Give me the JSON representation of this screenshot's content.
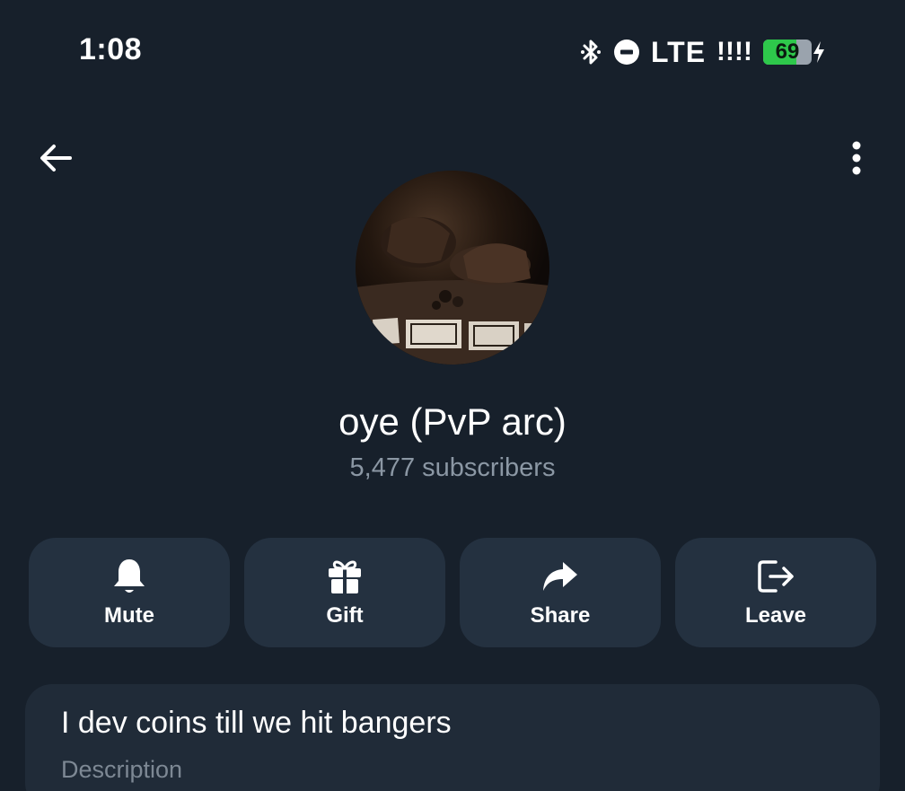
{
  "status_bar": {
    "time": "1:08",
    "network": "LTE",
    "signal": "!!!!",
    "battery_percent": "69",
    "battery_level": 0.69,
    "icons": [
      "bluetooth-icon",
      "do-not-disturb-icon",
      "battery-charging-icon"
    ]
  },
  "nav": {
    "back_icon": "arrow-left-icon",
    "more_icon": "more-vertical-icon"
  },
  "channel": {
    "title": "oye (PvP arc)",
    "subscribers": "5,477 subscribers"
  },
  "actions": [
    {
      "label": "Mute",
      "icon": "bell-icon"
    },
    {
      "label": "Gift",
      "icon": "gift-icon"
    },
    {
      "label": "Share",
      "icon": "share-arrow-icon"
    },
    {
      "label": "Leave",
      "icon": "leave-icon"
    }
  ],
  "info": {
    "description_text": "I dev coins till we hit bangers",
    "description_label": "Description"
  },
  "colors": {
    "background": "#17202b",
    "button_bg": "#243140",
    "card_bg": "#202b38",
    "secondary_text": "#8b97a4",
    "battery_green": "#2ec84b"
  }
}
